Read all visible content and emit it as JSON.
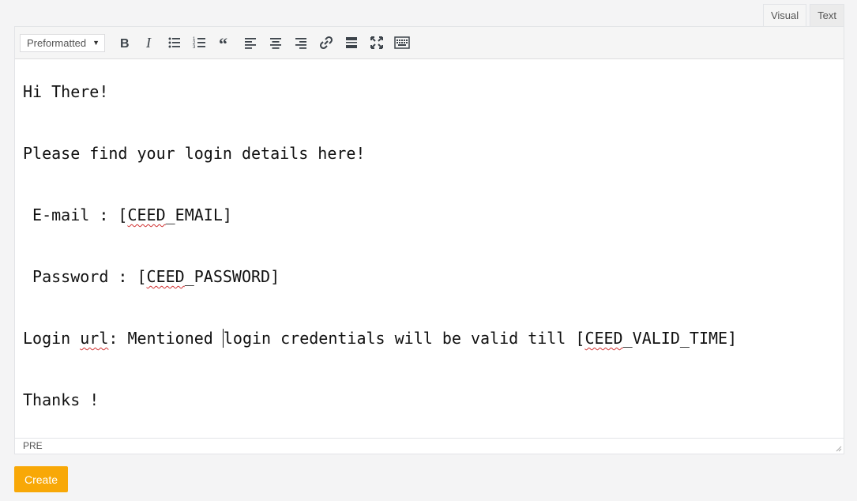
{
  "tabs": {
    "visual": "Visual",
    "text": "Text"
  },
  "toolbar": {
    "format_selected": "Preformatted",
    "buttons": [
      "bold-icon",
      "italic-icon",
      "bullet-list-icon",
      "numbered-list-icon",
      "blockquote-icon",
      "align-left-icon",
      "align-center-icon",
      "align-right-icon",
      "link-icon",
      "read-more-icon",
      "fullscreen-icon",
      "toolbar-toggle-icon"
    ]
  },
  "content": {
    "greeting": "Hi There!",
    "intro": "Please find your login details here!",
    "email_label": " E-mail : [",
    "email_token": "CEED",
    "email_rest": "_EMAIL]",
    "password_label": " Password : [",
    "password_token": "CEED",
    "password_rest": "_PASSWORD]",
    "login_prefix": "Login ",
    "login_url_word": "url",
    "login_mid": ": Mentioned ",
    "login_after_caret": "login credentials will be valid till [",
    "login_token": "CEED",
    "login_rest": "_VALID_TIME]",
    "thanks": "Thanks !"
  },
  "statusbar": {
    "path": "PRE"
  },
  "actions": {
    "create_label": "Create"
  },
  "colors": {
    "accent": "#f8a807",
    "spell_error": "#d03030"
  }
}
